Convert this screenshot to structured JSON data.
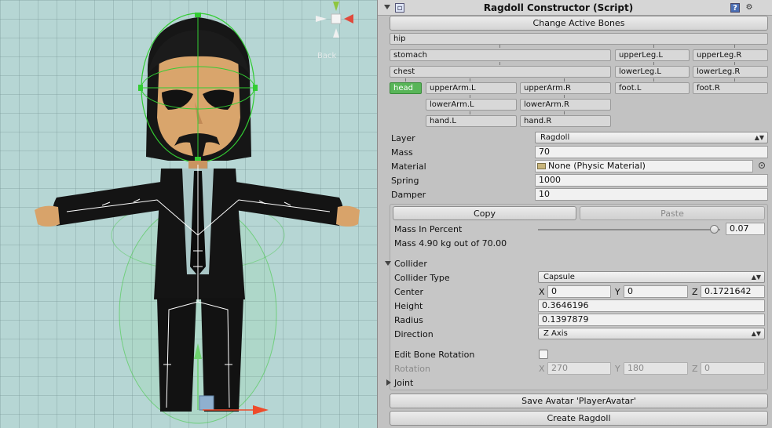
{
  "scene": {
    "view_label": "Back",
    "icons": [
      "character-model-icon",
      "scene-gizmo-icon",
      "move-handle-icon"
    ]
  },
  "inspector": {
    "title": "Ragdoll Constructor (Script)",
    "header_icons": [
      "script-icon",
      "help-icon",
      "settings-icon"
    ],
    "change_bones_label": "Change Active Bones",
    "bones": {
      "hip": "hip",
      "stomach": "stomach",
      "chest": "chest",
      "head": "head",
      "upperArmL": "upperArm.L",
      "upperArmR": "upperArm.R",
      "lowerArmL": "lowerArm.L",
      "lowerArmR": "lowerArm.R",
      "handL": "hand.L",
      "handR": "hand.R",
      "upperLegL": "upperLeg.L",
      "upperLegR": "upperLeg.R",
      "lowerLegL": "lowerLeg.L",
      "lowerLegR": "lowerLeg.R",
      "footL": "foot.L",
      "footR": "foot.R"
    },
    "active_bone": "head",
    "layer": {
      "label": "Layer",
      "value": "Ragdoll"
    },
    "mass": {
      "label": "Mass",
      "value": "70"
    },
    "material": {
      "label": "Material",
      "value": "None (Physic Material)"
    },
    "spring": {
      "label": "Spring",
      "value": "1000"
    },
    "damper": {
      "label": "Damper",
      "value": "10"
    },
    "copy_label": "Copy",
    "paste_label": "Paste",
    "mass_percent": {
      "label": "Mass In Percent",
      "value": "0.07",
      "fraction": 0.97
    },
    "mass_info": "Mass 4.90 kg out of 70.00",
    "collider": {
      "section_label": "Collider",
      "type_label": "Collider Type",
      "type_value": "Capsule",
      "center_label": "Center",
      "center": {
        "x_label": "X",
        "x": "0",
        "y_label": "Y",
        "y": "0",
        "z_label": "Z",
        "z": "0.1721642"
      },
      "height_label": "Height",
      "height": "0.3646196",
      "radius_label": "Radius",
      "radius": "0.1397879",
      "direction_label": "Direction",
      "direction": "Z Axis"
    },
    "edit_rotation_label": "Edit Bone Rotation",
    "rotation": {
      "label": "Rotation",
      "x_label": "X",
      "x": "270",
      "y_label": "Y",
      "y": "180",
      "z_label": "Z",
      "z": "0"
    },
    "joint_label": "Joint",
    "save_avatar_label": "Save Avatar 'PlayerAvatar'",
    "create_ragdoll_label": "Create Ragdoll"
  }
}
